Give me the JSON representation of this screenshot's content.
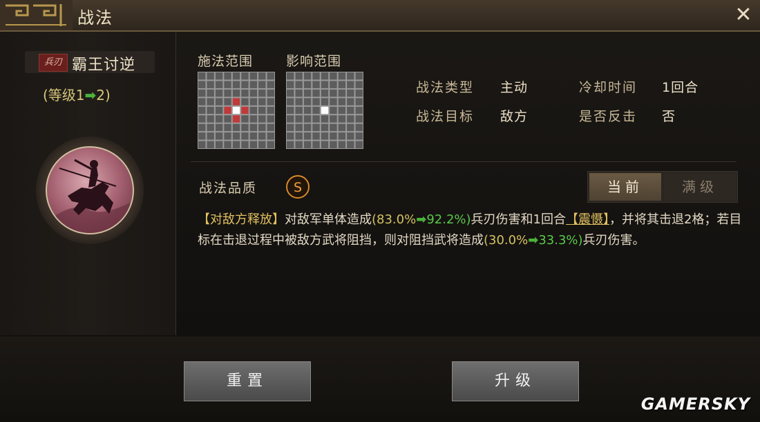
{
  "window": {
    "title": "战法"
  },
  "skill": {
    "type_tag": "兵刃",
    "name": "霸王讨逆",
    "level_prefix": "(等级1",
    "level_suffix": "2)"
  },
  "ranges": {
    "cast_range_label": "施法范围",
    "effect_range_label": "影响范围"
  },
  "stats": {
    "type_label": "战法类型",
    "type_value": "主动",
    "target_label": "战法目标",
    "target_value": "敌方",
    "cooldown_label": "冷却时间",
    "cooldown_value": "1回合",
    "counter_label": "是否反击",
    "counter_value": "否"
  },
  "quality": {
    "label": "战法品质",
    "grade": "S"
  },
  "tabs": {
    "current": "当前",
    "max": "满级"
  },
  "description": {
    "p1": "【对敌方释放】",
    "p2": "对敌军单体造成",
    "p3": "(83.0%",
    "p4": "92.2%)",
    "p5": "兵刃伤害和1回合",
    "p6": "【震慑】",
    "p7": "，并将其击退2格；若目标在击退过程中被敌方武将阻挡，则对阻挡武将造成",
    "p8": "(30.0%",
    "p9": "33.3%)",
    "p10": "兵刃伤害。"
  },
  "buttons": {
    "reset": "重置",
    "upgrade": "升级"
  },
  "watermark": "GAMERSKY",
  "colors": {
    "accent_gold": "#e0c060",
    "increase_green": "#5ac84a",
    "quality_orange": "#d88a2a"
  }
}
